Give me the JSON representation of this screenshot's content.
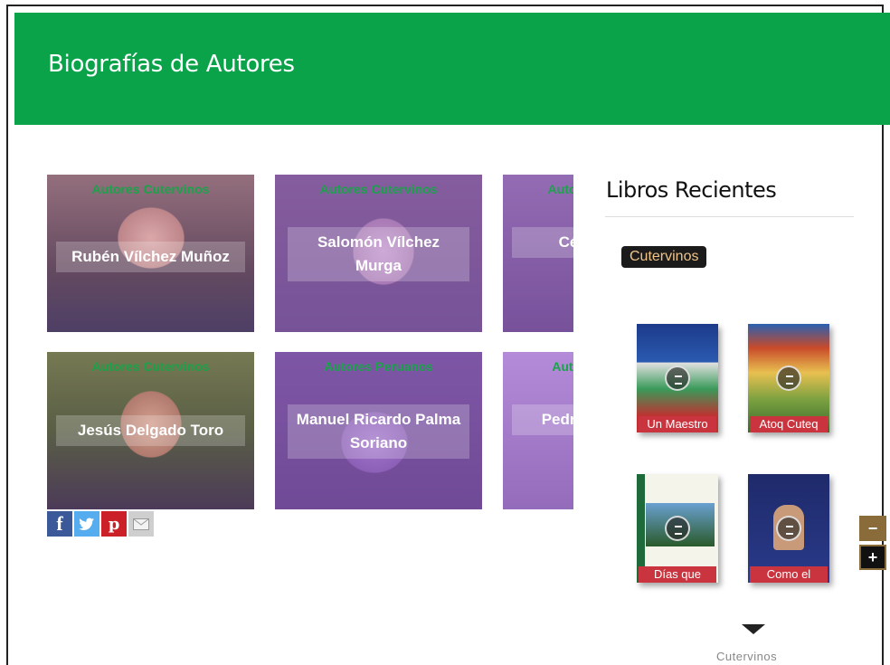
{
  "header": {
    "title": "Biografías de Autores"
  },
  "authors": [
    {
      "category": "Autores Cutervinos",
      "name": "Rubén Vílchez Muñoz"
    },
    {
      "category": "Autores Cutervinos",
      "name": "Salomón Vílchez Murga"
    },
    {
      "category": "Autores Cutervinos",
      "name": "César Vallejo"
    },
    {
      "category": "Autores Cutervinos",
      "name": "Jesús Delgado Toro"
    },
    {
      "category": "Autores Peruanos",
      "name": "Manuel Ricardo Palma Soriano"
    },
    {
      "category": "Autores Peruanos",
      "name": "Pedro Valdelomar"
    }
  ],
  "share": {
    "facebook": "f",
    "twitter": "t",
    "pinterest": "p",
    "email": "email-icon"
  },
  "sidebar": {
    "title": "Libros Recientes",
    "tag": "Cutervinos",
    "books": [
      {
        "caption": "Un Maestro"
      },
      {
        "caption": "Atoq Cuteq"
      },
      {
        "caption": "Días que"
      },
      {
        "caption": "Como el"
      }
    ],
    "bottom_label": "Cutervinos"
  },
  "zoom": {
    "minus": "−",
    "plus": "+"
  },
  "colors": {
    "header": "#0aa34a",
    "category": "#1aa34a",
    "caption": "#c9343f"
  }
}
